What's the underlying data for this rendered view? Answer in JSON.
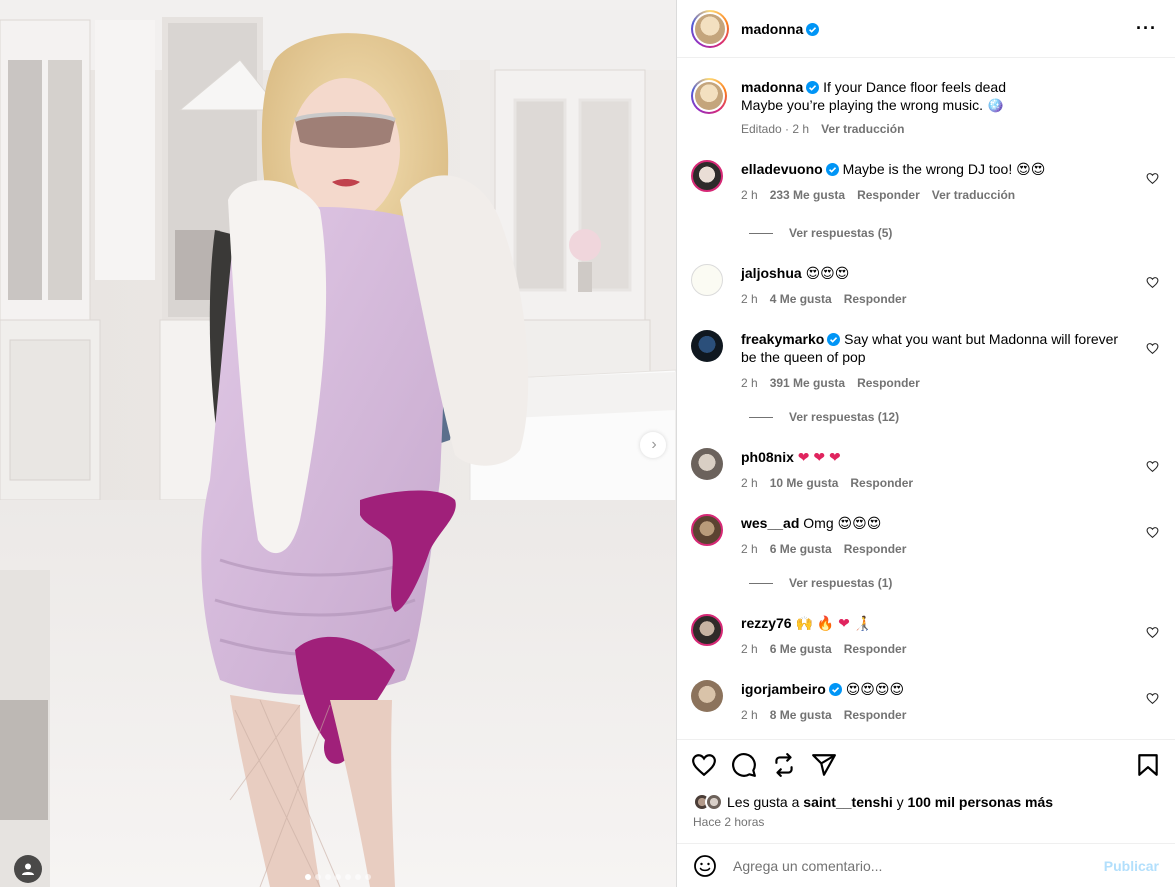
{
  "post": {
    "author": "madonna",
    "caption_line1": "If your Dance floor feels dead",
    "caption_line2": "Maybe you’re playing the wrong music. 🪩",
    "edited_label": "Editado",
    "time": "2 h",
    "translate_label": "Ver traducción"
  },
  "comments": [
    {
      "user": "elladevuono",
      "verified": true,
      "text": "Maybe is the wrong DJ too!",
      "emojis": [
        "heart-eyes",
        "heart-eyes"
      ],
      "time": "2 h",
      "likes": "233 Me gusta",
      "reply": "Responder",
      "translate": "Ver traducción",
      "replies": "Ver respuestas (5)"
    },
    {
      "user": "jaljoshua",
      "verified": false,
      "text": "",
      "emojis": [
        "heart-eyes",
        "heart-eyes",
        "heart-eyes"
      ],
      "time": "2 h",
      "likes": "4 Me gusta",
      "reply": "Responder"
    },
    {
      "user": "freakymarko",
      "verified": true,
      "text_line1": "Say what you want but Madonna will forever",
      "text_line2": "be the queen of pop",
      "time": "2 h",
      "likes": "391 Me gusta",
      "reply": "Responder",
      "replies": "Ver respuestas (12)"
    },
    {
      "user": "ph08nix",
      "verified": false,
      "emojis": [
        "red-heart",
        "red-heart",
        "red-heart"
      ],
      "time": "2 h",
      "likes": "10 Me gusta",
      "reply": "Responder"
    },
    {
      "user": "wes__ad",
      "verified": false,
      "text": "Omg",
      "emojis": [
        "heart-eyes",
        "heart-eyes",
        "heart-eyes"
      ],
      "time": "2 h",
      "likes": "6 Me gusta",
      "reply": "Responder",
      "replies": "Ver respuestas (1)"
    },
    {
      "user": "rezzy76",
      "verified": false,
      "emojis": [
        "raising-hands",
        "fire",
        "red-heart",
        "person-walking-cane"
      ],
      "time": "2 h",
      "likes": "6 Me gusta",
      "reply": "Responder"
    },
    {
      "user": "igorjambeiro",
      "verified": true,
      "emojis": [
        "heart-eyes",
        "heart-eyes",
        "heart-eyes",
        "heart-eyes"
      ],
      "time": "2 h",
      "likes": "8 Me gusta",
      "reply": "Responder"
    }
  ],
  "likes": {
    "prefix": "Les gusta a",
    "user": "saint__tenshi",
    "connector": "y",
    "others": "100 mil personas más"
  },
  "posted_ago": "Hace 2 horas",
  "comment_input": {
    "placeholder": "Agrega un comentario...",
    "publish_label": "Publicar"
  },
  "colors": {
    "verified": "#0095f6",
    "muted": "#737373",
    "publish_disabled": "#b2dffc"
  },
  "icons": [
    "more-options-icon",
    "verified-icon",
    "heart-icon",
    "comment-icon",
    "repost-icon",
    "share-icon",
    "save-icon",
    "emoji-icon",
    "next-arrow-icon",
    "user-tag-icon"
  ]
}
